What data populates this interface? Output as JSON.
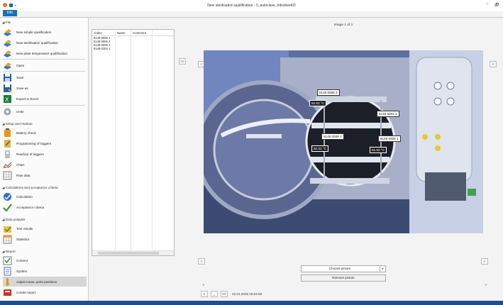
{
  "window": {
    "title": "New sterilisation qualification - 0_autoclave_Infosheet02",
    "minimize": "–",
    "maximize": "🗗"
  },
  "ribbon": {
    "info_tab": "Info"
  },
  "sidebar": {
    "sections": {
      "file": "File",
      "setup": "Setup and readout",
      "calc": "Calculations and acceptance criteria",
      "analysis": "Data analysis",
      "report": "Report"
    },
    "file_items": [
      "New simple qualification",
      "New sterilisation qualification",
      "New plate temperature qualification",
      "Open",
      "Save",
      "Save as",
      "Export to Excel",
      "Units"
    ],
    "setup_items": [
      "Battery check",
      "Programming of loggers",
      "Readout of loggers",
      "Chart",
      "Raw data"
    ],
    "calc_items": [
      "Calculation",
      "Acceptance criteria"
    ],
    "analysis_items": [
      "Test results",
      "Statistics"
    ],
    "report_items": [
      "Content",
      "System",
      "Adjust meas. point positions",
      "Create report"
    ]
  },
  "table": {
    "headers": {
      "index": "Index",
      "name": "Name",
      "comment": "Comment"
    },
    "rows": [
      "6148 0006 1",
      "6148 0006 2",
      "6148 0009 1",
      "6148 0304 1"
    ]
  },
  "image_viewer": {
    "counter": "Image 1 of 1",
    "tags": [
      "6148 0006 2",
      "62.63 °C",
      "6148 0304 1",
      "6148 0009 1",
      "6148 0006 1",
      "62.31 °C",
      "61.93 °C"
    ]
  },
  "controls": {
    "choose_picture": "Choose picture",
    "remove_picture": "Remove picture",
    "timestamp": "22.01.2019 16:04:00",
    "nav_prev": "<",
    "nav_next": ">",
    "nav_dash": "_",
    "nav_last": ">>",
    "nav_first": "<<",
    "arrow_left": "<",
    "arrow_right": ">"
  },
  "colors": {
    "accent": "#1e6fb8",
    "taskbar": "#1d4f8f"
  }
}
